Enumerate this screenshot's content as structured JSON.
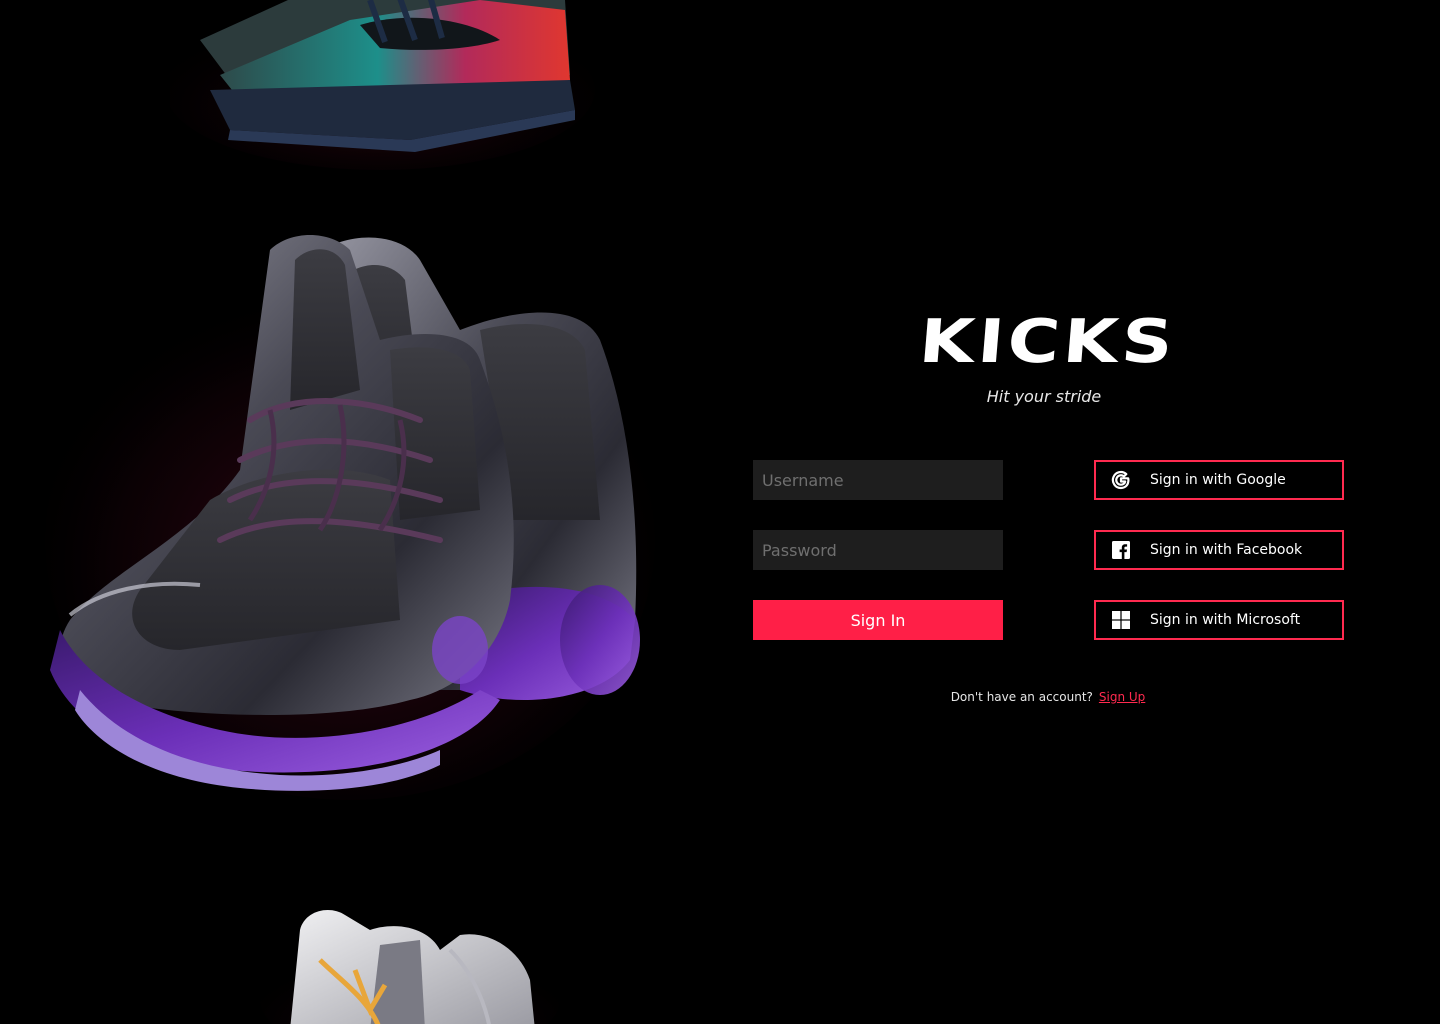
{
  "brand": {
    "logo": "KICKS",
    "tagline": "Hit your stride"
  },
  "login": {
    "username_placeholder": "Username",
    "password_placeholder": "Password",
    "signin_label": "Sign In"
  },
  "sso": {
    "google_label": "Sign in with Google",
    "facebook_label": "Sign in with Facebook",
    "microsoft_label": "Sign in with Microsoft"
  },
  "signup": {
    "prompt": "Don't have an account?",
    "link_label": "Sign Up"
  },
  "colors": {
    "background": "#000000",
    "accent": "#ff1f47",
    "input_background": "#1e1e1e"
  },
  "icons": [
    "google-icon",
    "facebook-icon",
    "microsoft-icon"
  ]
}
